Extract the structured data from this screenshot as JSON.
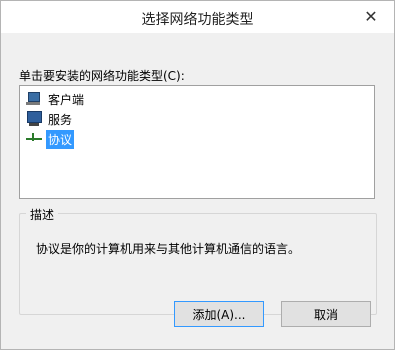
{
  "window": {
    "title": "选择网络功能类型",
    "close_glyph": "✕"
  },
  "prompt": "单击要安装的网络功能类型(C):",
  "list": {
    "items": [
      {
        "label": "客户端",
        "icon": "client-icon",
        "selected": false
      },
      {
        "label": "服务",
        "icon": "service-icon",
        "selected": false
      },
      {
        "label": "协议",
        "icon": "protocol-icon",
        "selected": true
      }
    ]
  },
  "description": {
    "group_title": "描述",
    "text": "协议是你的计算机用来与其他计算机通信的语言。"
  },
  "buttons": {
    "add": "添加(A)...",
    "cancel": "取消"
  },
  "colors": {
    "selection": "#3399ff",
    "background": "#f0f0f0",
    "default_button_border": "#3399ff"
  }
}
